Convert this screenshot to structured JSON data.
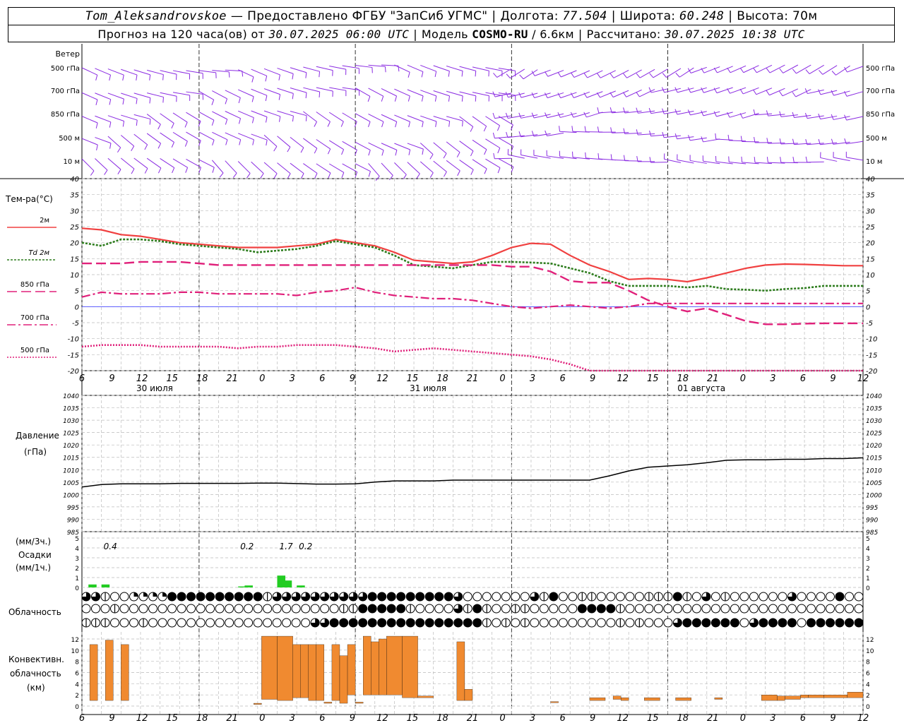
{
  "header": {
    "station": "Tom_Aleksandrovskoe",
    "dash": "—",
    "provider": "Предоставлено ФГБУ \"ЗапСиб УГМС\"",
    "lon_label": "Долгота:",
    "lon_value": "77.504",
    "lat_label": "Широта:",
    "lat_value": "60.248",
    "alt_label": "Высота:",
    "alt_value": "70м",
    "forecast_label": "Прогноз на 120 часа(ов) от",
    "forecast_start": "30.07.2025 06:00 UTC",
    "model_label": "Модель",
    "model_name": "COSMO-RU",
    "model_res": "/ 6.6км",
    "calc_label": "Рассчитано:",
    "calc_time": "30.07.2025 10:38 UTC"
  },
  "colors": {
    "t2m": "#f04040",
    "td2m": "#2e7d1e",
    "t850": "#e0207a",
    "t700": "#e0207a",
    "t500": "#e0207a",
    "zero_line": "#4040ff",
    "pressure": "#000000",
    "precip": "#22cc22",
    "convective": "#f08a30",
    "wind": "#8a2be2"
  },
  "chart_data": [
    {
      "type": "wind_barbs",
      "title": "Ветер",
      "levels": [
        "500 гПа",
        "700 гПа",
        "850 гПа",
        "500 м",
        "10 м"
      ]
    },
    {
      "type": "line",
      "ylabel": "Тем-ра(°C)",
      "ylim": [
        -20,
        40
      ],
      "yticks": [
        40,
        35,
        30,
        25,
        20,
        15,
        10,
        5,
        0,
        -5,
        -10,
        -15,
        -20
      ],
      "x_hours": [
        0,
        3,
        6,
        9,
        12,
        15,
        18,
        21,
        24,
        27,
        30,
        33,
        36,
        39,
        42,
        45,
        48,
        51,
        54,
        57,
        60,
        63,
        66,
        69,
        72,
        75,
        78,
        81,
        84,
        87,
        90,
        93,
        96,
        99,
        102,
        105,
        108,
        111,
        114,
        117,
        120
      ],
      "xtick_labels": [
        "6",
        "9",
        "12",
        "15",
        "18",
        "21",
        "0",
        "3",
        "6",
        "9",
        "12",
        "15",
        "18",
        "21",
        "0",
        "3",
        "6",
        "9",
        "12",
        "15",
        "18",
        "21",
        "0",
        "3",
        "6",
        "9",
        "12"
      ],
      "date_labels": [
        "30 июля",
        "31 июля",
        "01 августа"
      ],
      "series": [
        {
          "name": "2м",
          "style": "solid",
          "values": [
            24.5,
            24,
            22.5,
            22,
            21,
            20,
            19.5,
            19,
            18.5,
            18.5,
            18.5,
            19,
            19.5,
            21,
            20,
            19,
            17,
            14.5,
            14,
            13.5,
            14,
            16,
            18.5,
            19.8,
            19.5,
            16,
            13,
            11,
            8.5,
            8.8,
            8.5,
            7.8,
            9,
            10.5,
            12,
            13,
            13.3,
            13.2,
            13,
            12.8,
            12.8
          ]
        },
        {
          "name": "Td 2м",
          "style": "dotted",
          "values": [
            20,
            19,
            21,
            21,
            20.5,
            19.5,
            19,
            18.5,
            18,
            17,
            17.5,
            18,
            19,
            20.5,
            19.5,
            18.5,
            16,
            13,
            12.5,
            12,
            13,
            14,
            14,
            13.8,
            13.5,
            12,
            10.5,
            8,
            6.5,
            6.5,
            6.5,
            6,
            6.5,
            5.5,
            5.3,
            5,
            5.5,
            5.8,
            6.5,
            6.5,
            6.5
          ]
        },
        {
          "name": "850 гПа",
          "style": "longdash",
          "values": [
            13.5,
            13.5,
            13.5,
            14,
            14,
            14,
            13.5,
            13,
            13,
            13,
            13,
            13,
            13,
            13,
            13,
            13,
            13,
            13,
            13,
            13,
            13,
            13,
            12.5,
            12.5,
            11,
            8,
            7.5,
            7.5,
            5,
            2,
            0,
            -1.5,
            -0.5,
            -2.5,
            -4.5,
            -5.5,
            -5.5,
            -5.3,
            -5.2,
            -5.2,
            -5.2
          ]
        },
        {
          "name": "700 гПа",
          "style": "dashdot",
          "values": [
            3,
            4.5,
            4,
            4,
            4,
            4.5,
            4.5,
            4,
            4,
            4,
            4,
            3.5,
            4.5,
            5,
            6,
            4.5,
            3.5,
            3,
            2.5,
            2.5,
            2,
            1,
            0,
            -0.5,
            0,
            0.5,
            0,
            -0.5,
            0,
            1,
            1,
            1,
            1,
            1,
            1,
            1,
            1,
            1,
            1,
            1,
            1
          ]
        },
        {
          "name": "500 гПа",
          "style": "dense_dotted",
          "values": [
            -12.5,
            -12,
            -12,
            -12,
            -12.5,
            -12.5,
            -12.5,
            -12.5,
            -13,
            -12.5,
            -12.5,
            -12,
            -12,
            -12,
            -12.5,
            -13,
            -14,
            -13.5,
            -13,
            -13.5,
            -14,
            -14.5,
            -15,
            -15.5,
            -16.5,
            -18,
            -20,
            -20,
            -20,
            -20,
            -20,
            -20,
            -20,
            -20,
            -20,
            -20,
            -20,
            -20,
            -20,
            -20,
            -20
          ]
        }
      ]
    },
    {
      "type": "line",
      "ylabel": "Давление",
      "ylabel2": "(гПа)",
      "ylim": [
        985,
        1040
      ],
      "yticks": [
        1040,
        1035,
        1030,
        1025,
        1020,
        1015,
        1010,
        1005,
        1000,
        995,
        990,
        985
      ],
      "x_hours": [
        0,
        3,
        6,
        9,
        12,
        15,
        18,
        21,
        24,
        27,
        30,
        33,
        36,
        39,
        42,
        45,
        48,
        51,
        54,
        57,
        60,
        63,
        66,
        69,
        72,
        75,
        78,
        81,
        84,
        87,
        90,
        93,
        96,
        99,
        102,
        105,
        108,
        111,
        114,
        117,
        120
      ],
      "series": [
        {
          "name": "Давление",
          "values": [
            1003,
            1004,
            1004.3,
            1004.3,
            1004.3,
            1004.5,
            1004.5,
            1004.5,
            1004.5,
            1004.6,
            1004.6,
            1004.4,
            1004.2,
            1004.2,
            1004.3,
            1005,
            1005.5,
            1005.5,
            1005.5,
            1005.8,
            1005.8,
            1005.8,
            1005.8,
            1005.8,
            1005.8,
            1005.8,
            1005.8,
            1007.5,
            1009.5,
            1011,
            1011.5,
            1012,
            1012.8,
            1013.8,
            1014,
            1014,
            1014.2,
            1014.2,
            1014.5,
            1014.5,
            1014.8
          ]
        }
      ]
    },
    {
      "type": "bar",
      "ylabel": "(мм/3ч.)",
      "ylabel2": "Осадки",
      "ylabel3": "(мм/1ч.)",
      "ylim": [
        0,
        5
      ],
      "yticks": [
        5,
        4,
        3,
        2,
        1,
        0
      ],
      "totals": [
        {
          "text": "0.4",
          "hour": 3
        },
        {
          "text": "0.2",
          "hour": 24
        },
        {
          "text": "1.7",
          "hour": 30
        },
        {
          "text": "0.2",
          "hour": 33
        }
      ],
      "bars": [
        {
          "hour": 1,
          "value": 0.3
        },
        {
          "hour": 3,
          "value": 0.3
        },
        {
          "hour": 24,
          "value": 0.1
        },
        {
          "hour": 25,
          "value": 0.2
        },
        {
          "hour": 30,
          "value": 1.2
        },
        {
          "hour": 31,
          "value": 0.7
        },
        {
          "hour": 33,
          "value": 0.2
        }
      ]
    },
    {
      "type": "cloud_symbols",
      "ylabel": "Облачность",
      "rows": [
        "3320011114444444444233333333334444444443000000032400220000022242030200000030000400000000000000000000000000000000000000000",
        "0002000000000000000000000002244444200003242002200000444420000000000000000000000000000000000000000000000000000000000000000",
        "2220002000000000000000003344444444444444442020200000000020200034444440344440444444444444444444444004000000003000000330000"
      ]
    },
    {
      "type": "bar",
      "ylabel": "Конвективн.",
      "ylabel2": "облачность",
      "ylabel3": "(км)",
      "ylim": [
        0,
        13
      ],
      "yticks": [
        12,
        10,
        8,
        6,
        4,
        2,
        0
      ],
      "bars": [
        {
          "from": 1,
          "to": 2,
          "base": 1,
          "top": 11
        },
        {
          "from": 3,
          "to": 4,
          "base": 1,
          "top": 11.8
        },
        {
          "from": 5,
          "to": 6,
          "base": 1,
          "top": 11
        },
        {
          "from": 22,
          "to": 23,
          "base": 0.3,
          "top": 0.5
        },
        {
          "from": 23,
          "to": 25,
          "base": 1.2,
          "top": 12.5
        },
        {
          "from": 25,
          "to": 27,
          "base": 1,
          "top": 12.5
        },
        {
          "from": 27,
          "to": 28,
          "base": 1.5,
          "top": 11
        },
        {
          "from": 28,
          "to": 29,
          "base": 1.5,
          "top": 11
        },
        {
          "from": 29,
          "to": 30,
          "base": 1,
          "top": 11
        },
        {
          "from": 30,
          "to": 31,
          "base": 1,
          "top": 11
        },
        {
          "from": 31,
          "to": 32,
          "base": 0.5,
          "top": 0.7
        },
        {
          "from": 32,
          "to": 33,
          "base": 1,
          "top": 11
        },
        {
          "from": 33,
          "to": 34,
          "base": 0.5,
          "top": 9
        },
        {
          "from": 34,
          "to": 35,
          "base": 2,
          "top": 11
        },
        {
          "from": 35,
          "to": 36,
          "base": 0.5,
          "top": 0.7
        },
        {
          "from": 36,
          "to": 37,
          "base": 2,
          "top": 12.5
        },
        {
          "from": 37,
          "to": 38,
          "base": 2,
          "top": 11.5
        },
        {
          "from": 38,
          "to": 39,
          "base": 2,
          "top": 12
        },
        {
          "from": 39,
          "to": 41,
          "base": 2,
          "top": 12.5
        },
        {
          "from": 41,
          "to": 43,
          "base": 1.5,
          "top": 12.5
        },
        {
          "from": 43,
          "to": 45,
          "base": 1.5,
          "top": 1.8
        },
        {
          "from": 48,
          "to": 49,
          "base": 1,
          "top": 11.5
        },
        {
          "from": 49,
          "to": 50,
          "base": 1,
          "top": 3
        },
        {
          "from": 60,
          "to": 61,
          "base": 0.6,
          "top": 0.8
        },
        {
          "from": 65,
          "to": 67,
          "base": 1,
          "top": 1.5
        },
        {
          "from": 68,
          "to": 69,
          "base": 1.2,
          "top": 1.8
        },
        {
          "from": 69,
          "to": 70,
          "base": 1,
          "top": 1.5
        },
        {
          "from": 72,
          "to": 74,
          "base": 1,
          "top": 1.5
        },
        {
          "from": 76,
          "to": 78,
          "base": 1,
          "top": 1.5
        },
        {
          "from": 81,
          "to": 82,
          "base": 1.2,
          "top": 1.5
        },
        {
          "from": 87,
          "to": 89,
          "base": 1,
          "top": 2
        },
        {
          "from": 89,
          "to": 90,
          "base": 1,
          "top": 1.8
        },
        {
          "from": 90,
          "to": 92,
          "base": 1.2,
          "top": 1.8
        },
        {
          "from": 92,
          "to": 93,
          "base": 1.5,
          "top": 2
        },
        {
          "from": 93,
          "to": 95,
          "base": 1.5,
          "top": 2
        },
        {
          "from": 95,
          "to": 98,
          "base": 1.5,
          "top": 2
        },
        {
          "from": 98,
          "to": 100,
          "base": 1.5,
          "top": 2.5
        }
      ]
    }
  ]
}
